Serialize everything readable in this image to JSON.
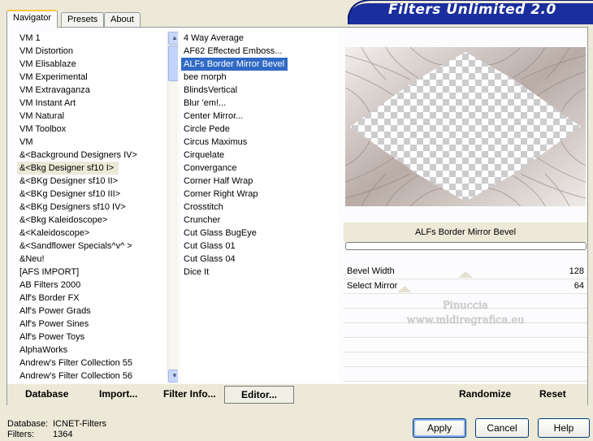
{
  "tabs": [
    "Navigator",
    "Presets",
    "About"
  ],
  "banner": {
    "title": "Filters Unlimited 2.0"
  },
  "categories": {
    "items": [
      "VM 1",
      "VM Distortion",
      "VM Elisablaze",
      "VM Experimental",
      "VM Extravaganza",
      "VM Instant Art",
      "VM Natural",
      "VM Toolbox",
      "VM",
      "&<Background Designers IV>",
      "&<Bkg Designer sf10 I>",
      "&<BKg Designer sf10 II>",
      "&<BKg Designer sf10 III>",
      "&<BKg Designers sf10 IV>",
      "&<Bkg Kaleidoscope>",
      "&<Kaleidoscope>",
      "&<Sandflower Specials^v^ >",
      "&Neu!",
      "[AFS IMPORT]",
      "AB Filters 2000",
      "Alf's Border FX",
      "Alf's Power Grads",
      "Alf's Power Sines",
      "Alf's Power Toys",
      "AlphaWorks",
      "Andrew's Filter Collection 55",
      "Andrew's Filter Collection 56"
    ],
    "selected_index": 10
  },
  "filters": {
    "items": [
      "4 Way Average",
      "AF62 Effected Emboss...",
      "ALFs Border Mirror Bevel",
      "bee morph",
      "BlindsVertical",
      "Blur 'em!...",
      "Center Mirror...",
      "Circle Pede",
      "Circus Maximus",
      "Cirquelate",
      "Convergance",
      "Corner Half Wrap",
      "Corner Right Wrap",
      "Crosstitch",
      "Cruncher",
      "Cut Glass  BugEye",
      "Cut Glass 01",
      "Cut Glass 04",
      "Dice It"
    ],
    "selected_index": 2
  },
  "preview": {
    "filter_name": "ALFs Border Mirror Bevel",
    "progress": 0
  },
  "params": [
    {
      "label": "Bevel Width",
      "value": "128",
      "fraction": 0.5
    },
    {
      "label": "Select Mirror",
      "value": "64",
      "fraction": 0.25
    }
  ],
  "watermark": {
    "line1": "Pinuccia",
    "line2": "www.mldiregrafica.eu"
  },
  "panel_buttons": {
    "database": "Database",
    "import": "Import...",
    "filter_info": "Filter Info...",
    "editor": "Editor...",
    "randomize": "Randomize",
    "reset": "Reset"
  },
  "footer": {
    "database_label": "Database:",
    "database_value": "ICNET-Filters",
    "filters_label": "Filters:",
    "filters_value": "1364"
  },
  "dialog_buttons": {
    "apply": "Apply",
    "cancel": "Cancel",
    "help": "Help"
  },
  "colors": {
    "banner_blue": "#1b2e9e",
    "selection": "#316ac5",
    "bevel_tint": "#c9bdb8"
  }
}
